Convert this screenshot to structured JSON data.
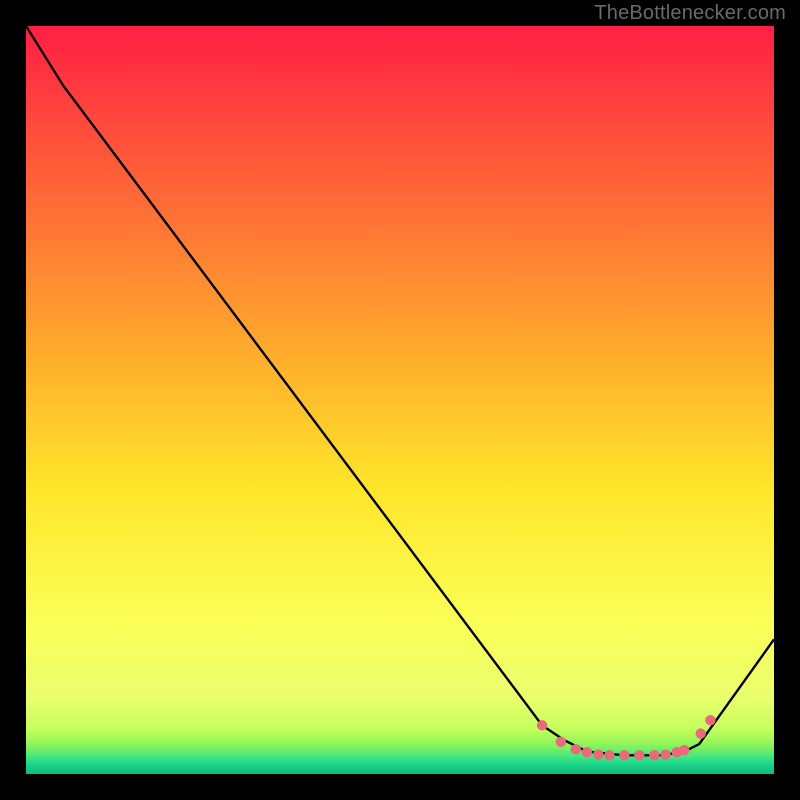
{
  "attribution": "TheBottlenecker.com",
  "chart_data": {
    "type": "line",
    "title": "",
    "xlabel": "",
    "ylabel": "",
    "xlim": [
      0,
      100
    ],
    "ylim": [
      0,
      100
    ],
    "series": [
      {
        "name": "curve",
        "path": [
          [
            0,
            100
          ],
          [
            5,
            92
          ],
          [
            69,
            6.5
          ],
          [
            72,
            4.5
          ],
          [
            75,
            3
          ],
          [
            80,
            2.5
          ],
          [
            85,
            2.5
          ],
          [
            88,
            3
          ],
          [
            90,
            4
          ],
          [
            100,
            18
          ]
        ]
      }
    ],
    "markers": {
      "name": "dots",
      "points": [
        [
          69,
          6.5
        ],
        [
          71.5,
          4.3
        ],
        [
          73.5,
          3.3
        ],
        [
          75,
          2.9
        ],
        [
          76.5,
          2.6
        ],
        [
          78,
          2.5
        ],
        [
          80,
          2.5
        ],
        [
          82,
          2.5
        ],
        [
          84,
          2.5
        ],
        [
          85.5,
          2.6
        ],
        [
          87,
          2.9
        ],
        [
          88,
          3.2
        ],
        [
          90.2,
          5.4
        ],
        [
          91.5,
          7.2
        ]
      ]
    },
    "background_gradient": {
      "stops": [
        [
          0.0,
          "#ff1f44"
        ],
        [
          0.45,
          "#ffb02b"
        ],
        [
          0.62,
          "#ffe62b"
        ],
        [
          0.8,
          "#fbff58"
        ],
        [
          0.9,
          "#e9ff6e"
        ],
        [
          0.94,
          "#c4ff5c"
        ],
        [
          0.96,
          "#90f55a"
        ],
        [
          0.975,
          "#4fe87a"
        ],
        [
          0.985,
          "#1fd98b"
        ],
        [
          1.0,
          "#0dba7a"
        ]
      ]
    },
    "marker_color": "#e96a78",
    "line_color": "#000000"
  }
}
